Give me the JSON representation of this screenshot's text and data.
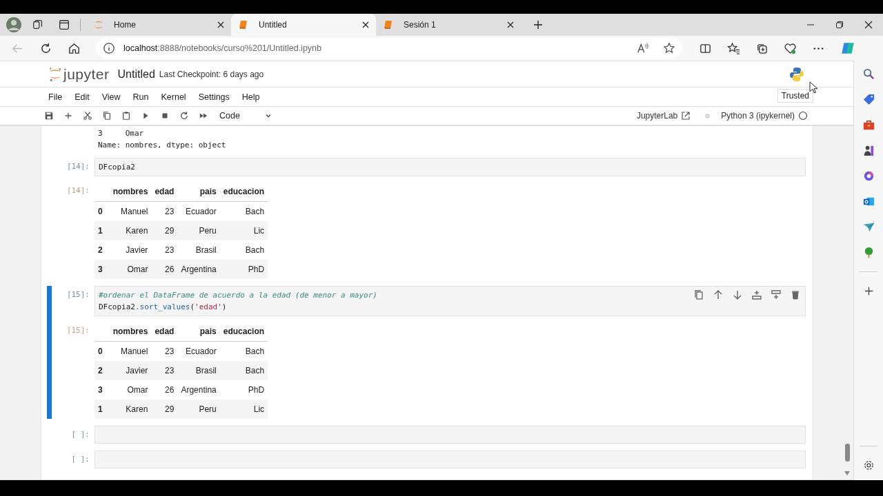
{
  "browser": {
    "tabs": [
      {
        "title": "Home",
        "kind": "jupyter",
        "selected": false
      },
      {
        "title": "Untitled",
        "kind": "notebook",
        "selected": true
      },
      {
        "title": "Sesión 1",
        "kind": "notebook",
        "selected": false
      }
    ],
    "address": {
      "host": "localhost",
      "rest": ":8888/notebooks/curso%201/Untitled.ipynb"
    }
  },
  "header": {
    "logo": "jupyter",
    "title": "Untitled",
    "checkpoint": "Last Checkpoint: 6 days ago",
    "tooltip": "Trusted"
  },
  "menu": [
    "File",
    "Edit",
    "View",
    "Run",
    "Kernel",
    "Settings",
    "Help"
  ],
  "toolbar": {
    "cell_type": "Code",
    "open_in": "JupyterLab",
    "kernel": "Python 3 (ipykernel)"
  },
  "cells": [
    {
      "selected": false,
      "output": {
        "kind": "stream",
        "lines": [
          "3     Omar",
          "Name: nombres, dtype: object"
        ]
      }
    },
    {
      "selected": false,
      "prompt": "[14]:",
      "input": [
        [
          {
            "text": "DFcopia2",
            "kind": "name"
          }
        ]
      ],
      "output": {
        "kind": "table",
        "prompt": "[14]:",
        "columns": [
          "nombres",
          "edad",
          "pais",
          "educacion"
        ],
        "rows": [
          {
            "index": "0",
            "values": [
              "Manuel",
              "23",
              "Ecuador",
              "Bach"
            ]
          },
          {
            "index": "1",
            "values": [
              "Karen",
              "29",
              "Peru",
              "Lic"
            ]
          },
          {
            "index": "2",
            "values": [
              "Javier",
              "23",
              "Brasil",
              "Bach"
            ]
          },
          {
            "index": "3",
            "values": [
              "Omar",
              "26",
              "Argentina",
              "PhD"
            ]
          }
        ]
      }
    },
    {
      "selected": true,
      "prompt": "[15]:",
      "input": [
        [
          {
            "text": "#ordenar el DataFrame de acuerdo a la edad (de menor a mayor)",
            "kind": "comment"
          }
        ],
        [
          {
            "text": "DFcopia2",
            "kind": "name"
          },
          {
            "text": ".sort_values",
            "kind": "method"
          },
          {
            "text": "(",
            "kind": "punct"
          },
          {
            "text": "'edad'",
            "kind": "string"
          },
          {
            "text": ")",
            "kind": "punct"
          }
        ]
      ],
      "output": {
        "kind": "table",
        "prompt": "[15]:",
        "columns": [
          "nombres",
          "edad",
          "pais",
          "educacion"
        ],
        "rows": [
          {
            "index": "0",
            "values": [
              "Manuel",
              "23",
              "Ecuador",
              "Bach"
            ]
          },
          {
            "index": "2",
            "values": [
              "Javier",
              "23",
              "Brasil",
              "Bach"
            ]
          },
          {
            "index": "3",
            "values": [
              "Omar",
              "26",
              "Argentina",
              "PhD"
            ]
          },
          {
            "index": "1",
            "values": [
              "Karen",
              "29",
              "Peru",
              "Lic"
            ]
          }
        ]
      }
    },
    {
      "selected": false,
      "prompt": "[ ]:"
    },
    {
      "selected": false,
      "prompt": "[ ]:"
    }
  ]
}
